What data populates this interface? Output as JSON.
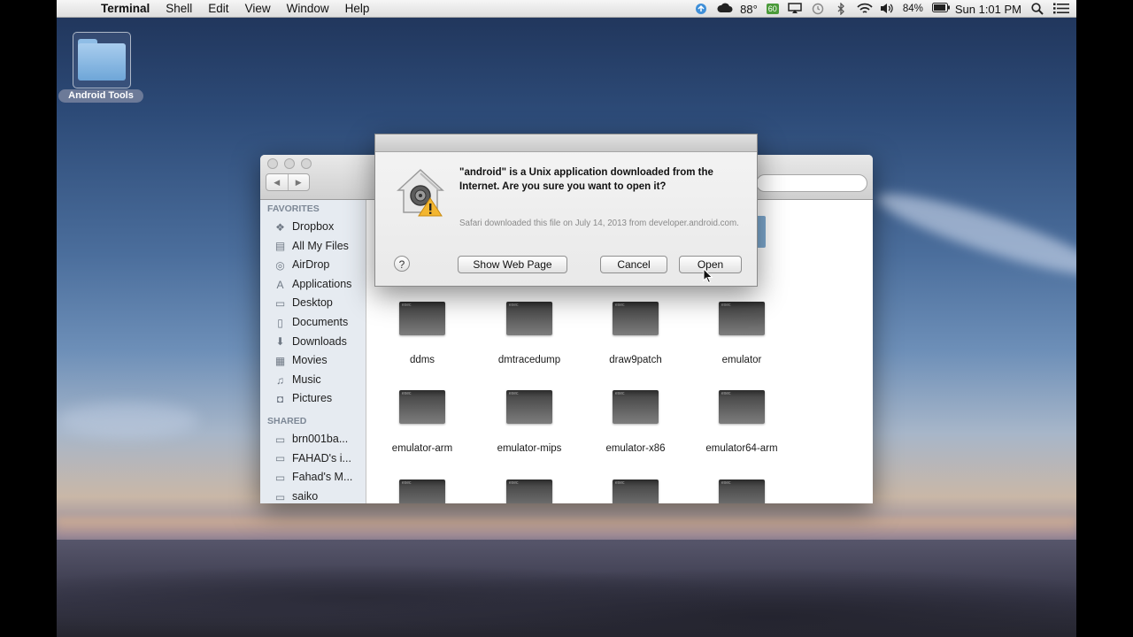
{
  "menubar": {
    "apple_glyph": "",
    "app_name": "Terminal",
    "items": [
      "Shell",
      "Edit",
      "View",
      "Window",
      "Help"
    ],
    "status": {
      "temperature": "88°",
      "temp_badge": "60",
      "battery": "84%",
      "clock": "Sun 1:01 PM"
    }
  },
  "desktop": {
    "folder_label": "Android Tools"
  },
  "finder": {
    "nav_back": "◀",
    "nav_forward": "▶",
    "favorites_header": "FAVORITES",
    "favorites": [
      {
        "label": "Dropbox",
        "icon": "dropbox-icon",
        "glyph": "❖"
      },
      {
        "label": "All My Files",
        "icon": "all-files-icon",
        "glyph": "▤"
      },
      {
        "label": "AirDrop",
        "icon": "airdrop-icon",
        "glyph": "◎"
      },
      {
        "label": "Applications",
        "icon": "applications-icon",
        "glyph": "A"
      },
      {
        "label": "Desktop",
        "icon": "desktop-icon",
        "glyph": "▭"
      },
      {
        "label": "Documents",
        "icon": "documents-icon",
        "glyph": "▯"
      },
      {
        "label": "Downloads",
        "icon": "downloads-icon",
        "glyph": "⬇"
      },
      {
        "label": "Movies",
        "icon": "movies-icon",
        "glyph": "▦"
      },
      {
        "label": "Music",
        "icon": "music-icon",
        "glyph": "♫"
      },
      {
        "label": "Pictures",
        "icon": "pictures-icon",
        "glyph": "◘"
      }
    ],
    "shared_header": "SHARED",
    "shared": [
      {
        "label": "brn001ba...",
        "icon": "network-device-icon",
        "glyph": "▭"
      },
      {
        "label": "FAHAD's i...",
        "icon": "network-computer-icon",
        "glyph": "▭"
      },
      {
        "label": "Fahad's M...",
        "icon": "network-computer-icon",
        "glyph": "▭"
      },
      {
        "label": "saiko",
        "icon": "network-computer-icon",
        "glyph": "▭"
      }
    ],
    "files": [
      {
        "name": "ddms"
      },
      {
        "name": "dmtracedump"
      },
      {
        "name": "draw9patch"
      },
      {
        "name": "emulator"
      },
      {
        "name": "emulator-arm"
      },
      {
        "name": "emulator-mips"
      },
      {
        "name": "emulator-x86"
      },
      {
        "name": "emulator64-arm"
      },
      {
        "name": ""
      },
      {
        "name": ""
      },
      {
        "name": ""
      },
      {
        "name": ""
      }
    ]
  },
  "dialog": {
    "message": "\"android\" is a Unix application downloaded from the Internet. Are you sure you want to open it?",
    "info": "Safari downloaded this file on July 14, 2013 from developer.android.com.",
    "help_label": "?",
    "show_web_page_label": "Show Web Page",
    "cancel_label": "Cancel",
    "open_label": "Open"
  }
}
